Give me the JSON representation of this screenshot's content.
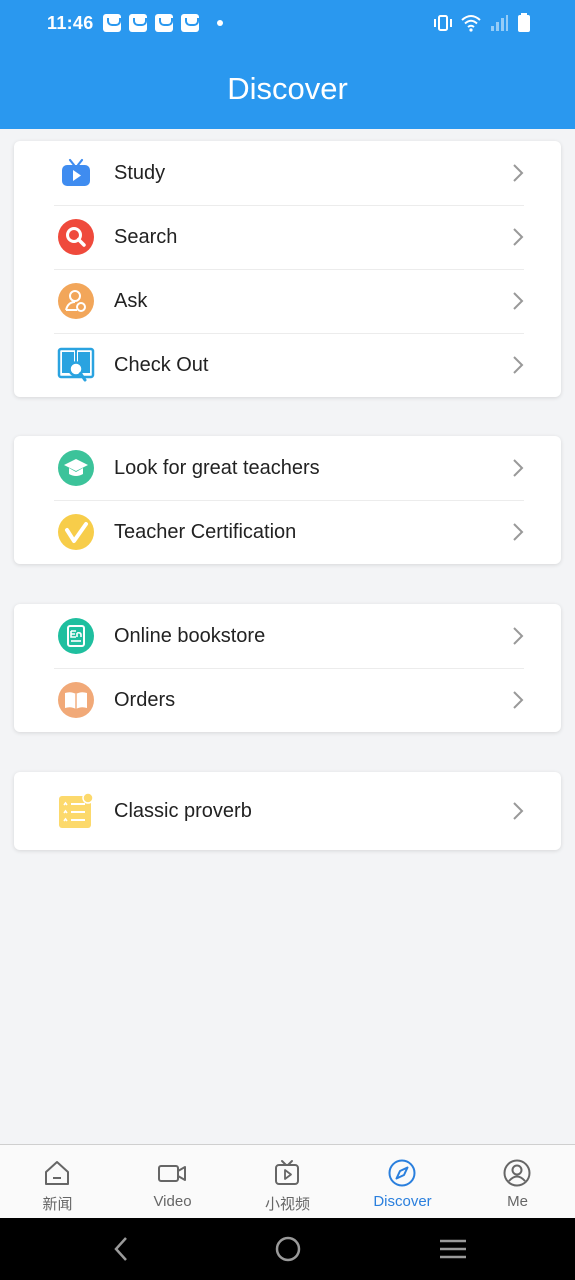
{
  "status": {
    "time": "11:46"
  },
  "header": {
    "title": "Discover"
  },
  "groups": [
    {
      "items": [
        {
          "label": "Study",
          "icon": "tv-play-icon"
        },
        {
          "label": "Search",
          "icon": "search-icon"
        },
        {
          "label": "Ask",
          "icon": "person-question-icon"
        },
        {
          "label": "Check Out",
          "icon": "book-magnifier-icon"
        }
      ]
    },
    {
      "items": [
        {
          "label": "Look for great teachers",
          "icon": "graduation-cap-icon"
        },
        {
          "label": "Teacher Certification",
          "icon": "checkmark-badge-icon"
        }
      ]
    },
    {
      "items": [
        {
          "label": "Online bookstore",
          "icon": "english-book-icon"
        },
        {
          "label": "Orders",
          "icon": "open-book-icon"
        }
      ]
    },
    {
      "items": [
        {
          "label": "Classic proverb",
          "icon": "list-star-icon"
        }
      ]
    }
  ],
  "bottom_nav": {
    "tabs": [
      {
        "label": "新闻",
        "icon": "home-icon"
      },
      {
        "label": "Video",
        "icon": "video-camera-icon"
      },
      {
        "label": "小视频",
        "icon": "tv-play-small-icon"
      },
      {
        "label": "Discover",
        "icon": "compass-icon",
        "active": true
      },
      {
        "label": "Me",
        "icon": "user-circle-icon"
      }
    ]
  },
  "colors": {
    "primary": "#2a98ef",
    "active_tab": "#2a7fdd",
    "text": "#222222"
  }
}
